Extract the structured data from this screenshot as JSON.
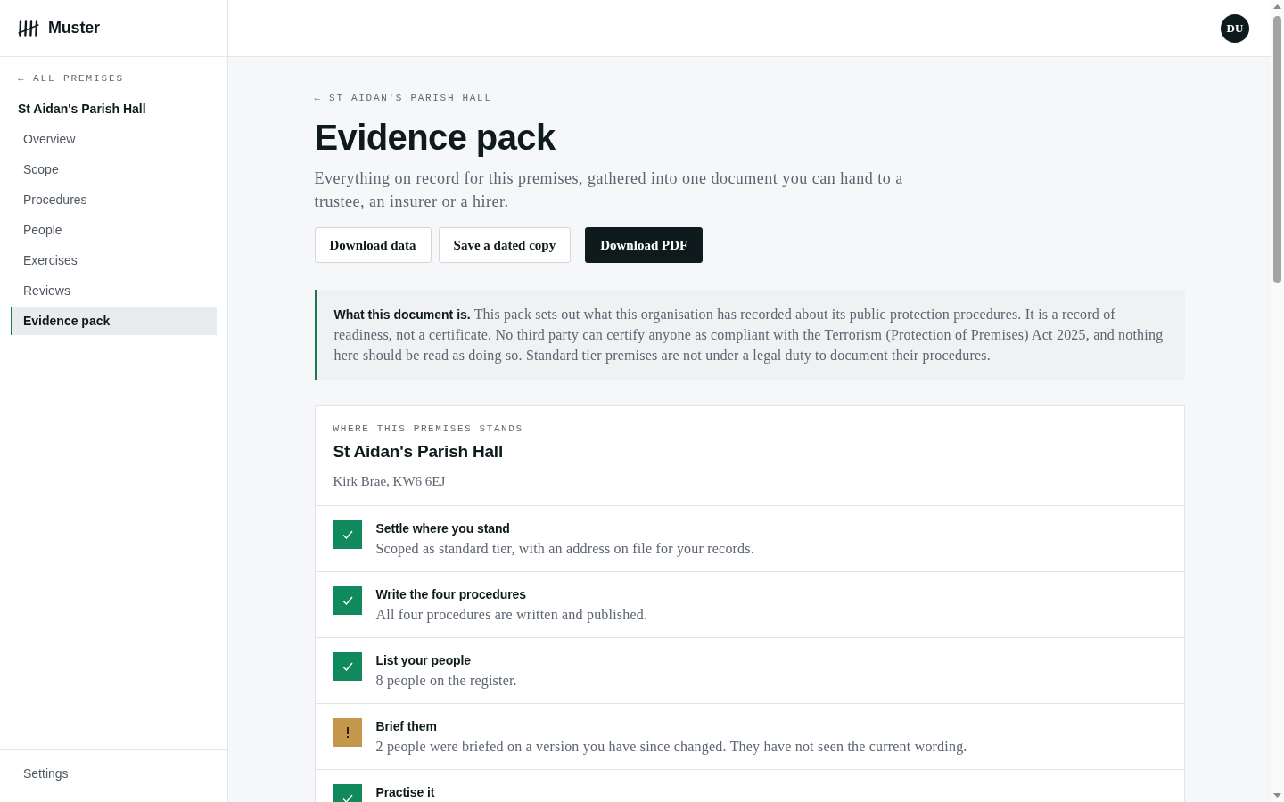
{
  "app": {
    "name": "Muster"
  },
  "sidebar": {
    "back_link": "← ALL PREMISES",
    "premises": "St Aidan's Parish Hall",
    "items": [
      {
        "label": "Overview",
        "selected": false
      },
      {
        "label": "Scope",
        "selected": false
      },
      {
        "label": "Procedures",
        "selected": false
      },
      {
        "label": "People",
        "selected": false
      },
      {
        "label": "Exercises",
        "selected": false
      },
      {
        "label": "Reviews",
        "selected": false
      },
      {
        "label": "Evidence pack",
        "selected": true
      }
    ],
    "footer_items": [
      {
        "label": "Settings",
        "selected": false
      }
    ]
  },
  "header": {
    "avatar": "DU"
  },
  "page": {
    "breadcrumb": "← ST AIDAN'S PARISH HALL",
    "title": "Evidence pack",
    "description": "Everything on record for this premises, gathered into one document you can hand to a trustee, an insurer or a hirer.",
    "buttons": [
      {
        "label": "Download data",
        "kind": "secondary"
      },
      {
        "label": "Save a dated copy",
        "kind": "secondary"
      },
      {
        "label": "Download PDF",
        "kind": "primary"
      }
    ]
  },
  "notice": {
    "text": "**What this document is.** This pack sets out what this organisation has recorded about its public protection procedures. It is a record of readiness, not a certificate. No third party can certify anyone as compliant with the Terrorism (Protection of Premises) Act 2025, and nothing here should be read as doing so. Standard tier premises are not under a legal duty to document their procedures."
  },
  "status_card": {
    "eyebrow": "WHERE THIS PREMISES STANDS",
    "name": "St Aidan's Parish Hall",
    "address": "Kirk Brae, KW6 6EJ",
    "steps": [
      {
        "kind": "done",
        "title": "Settle where you stand",
        "detail": "Scoped as standard tier, with an address on file for your records."
      },
      {
        "kind": "done",
        "title": "Write the four procedures",
        "detail": "All four procedures are written and published."
      },
      {
        "kind": "done",
        "title": "List your people",
        "detail": "8 people on the register."
      },
      {
        "kind": "warning",
        "title": "Brief them",
        "detail": "2 people were briefed on a version you have since changed. They have not seen the current wording."
      },
      {
        "kind": "done",
        "title": "Practise it"
      }
    ]
  }
}
